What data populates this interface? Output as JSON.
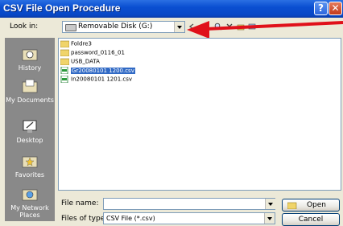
{
  "window": {
    "title": "CSV File Open Procedure",
    "help_glyph": "?",
    "close_glyph": "✕"
  },
  "lookin": {
    "label": "Look in:",
    "value": "Removable Disk (G:)"
  },
  "toolbar": {
    "icons": [
      "back-icon",
      "up-folder-icon",
      "search-icon",
      "delete-icon",
      "new-folder-icon",
      "views-icon"
    ]
  },
  "annotation": {
    "color": "#e0101a"
  },
  "places": [
    {
      "label": "History",
      "icon": "history-icon"
    },
    {
      "label": "My Documents",
      "icon": "my-documents-icon"
    },
    {
      "label": "Desktop",
      "icon": "desktop-icon"
    },
    {
      "label": "Favorites",
      "icon": "favorites-icon"
    },
    {
      "label": "My Network Places",
      "icon": "network-places-icon"
    }
  ],
  "files": [
    {
      "name": "Foldre3",
      "type": "folder"
    },
    {
      "name": "password_0116_01",
      "type": "folder"
    },
    {
      "name": "USB_DATA",
      "type": "folder"
    },
    {
      "name": "Gr20080101 1200.csv",
      "type": "csv",
      "selected": true
    },
    {
      "name": "In20080101 1201.csv",
      "type": "csv"
    }
  ],
  "filename": {
    "label": "File name:",
    "value": ""
  },
  "filetype": {
    "label": "Files of type:",
    "value": "CSV File (*.csv)"
  },
  "buttons": {
    "open": "Open",
    "cancel": "Cancel"
  },
  "colors": {
    "title_bar": "#0a4fd1",
    "selection": "#316ac5",
    "places_bg": "#898989",
    "annotation_arrow": "#e0101a"
  }
}
